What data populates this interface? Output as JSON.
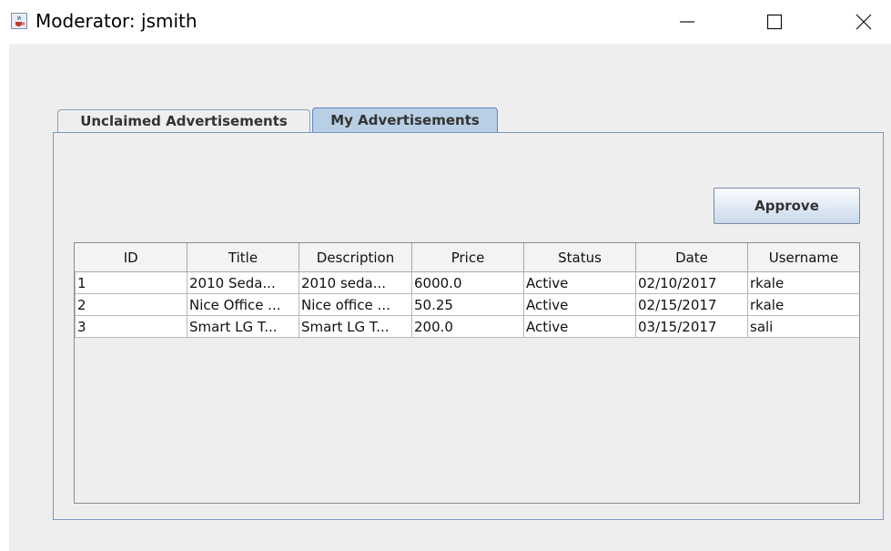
{
  "window": {
    "title": "Moderator: jsmith",
    "icon": "java-cup-icon",
    "controls": [
      "minimize-icon",
      "maximize-icon",
      "close-icon"
    ]
  },
  "tabs": [
    {
      "label": "Unclaimed Advertisements",
      "selected": false
    },
    {
      "label": "My Advertisements",
      "selected": true
    }
  ],
  "approve_label": "Approve",
  "table": {
    "columns": [
      "ID",
      "Title",
      "Description",
      "Price",
      "Status",
      "Date",
      "Username"
    ],
    "rows": [
      [
        "1",
        "2010 Seda...",
        "2010 seda...",
        "6000.0",
        "Active",
        "02/10/2017",
        "rkale"
      ],
      [
        "2",
        "Nice Office ...",
        "Nice office ...",
        "50.25",
        "Active",
        "02/15/2017",
        "rkale"
      ],
      [
        "3",
        "Smart LG T...",
        "Smart LG T...",
        "200.0",
        "Active",
        "03/15/2017",
        "sali"
      ]
    ]
  },
  "colors": {
    "selected_tab": "#b8cfe5",
    "panel_border": "#7a98c4",
    "client_background": "#eeeeee"
  }
}
